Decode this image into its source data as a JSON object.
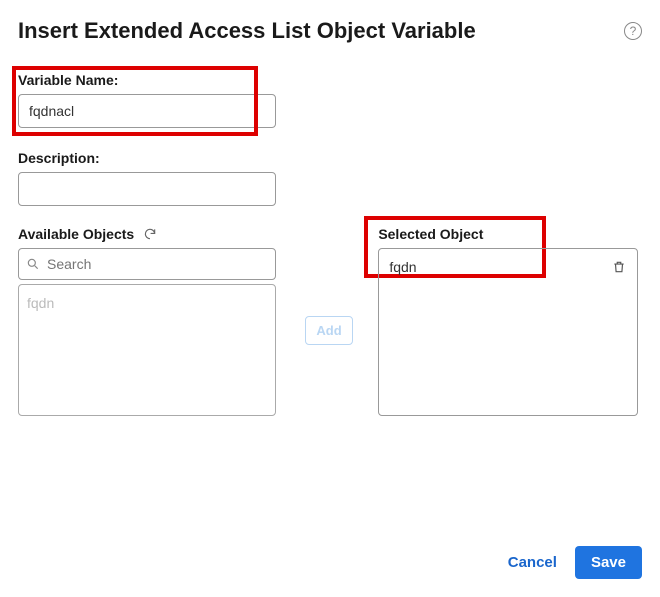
{
  "header": {
    "title": "Insert Extended Access List Object Variable"
  },
  "form": {
    "variable_name_label": "Variable Name:",
    "variable_name_value": "fqdnacl",
    "description_label": "Description:",
    "description_value": ""
  },
  "available": {
    "header": "Available Objects",
    "search_placeholder": "Search",
    "items": [
      "fqdn"
    ]
  },
  "middle": {
    "add_label": "Add"
  },
  "selected": {
    "header": "Selected Object",
    "items": [
      "fqdn"
    ]
  },
  "footer": {
    "cancel_label": "Cancel",
    "save_label": "Save"
  }
}
